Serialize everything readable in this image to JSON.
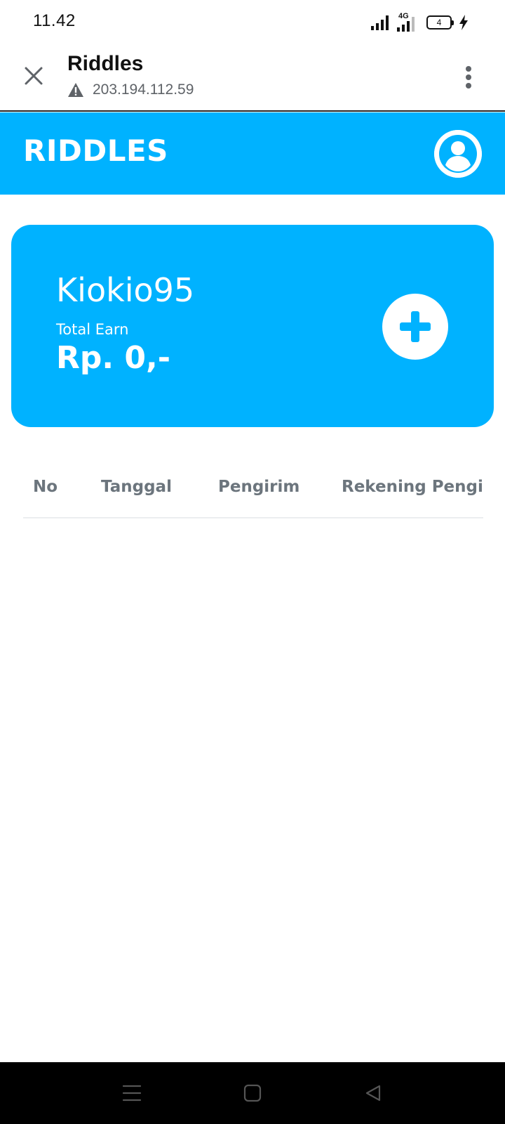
{
  "status_bar": {
    "time": "11.42",
    "network_label": "4G",
    "battery_level": "4",
    "icons": [
      "signal-icon",
      "4g-signal-icon",
      "battery-icon",
      "charging-icon"
    ]
  },
  "browser": {
    "title": "Riddles",
    "url": "203.194.112.59",
    "icons": [
      "close-icon",
      "warning-icon",
      "more-vert-icon"
    ]
  },
  "header": {
    "title": "RIDDLES",
    "icon": "account-circle-icon"
  },
  "card": {
    "username": "Kiokio95",
    "earn_label": "Total Earn",
    "earn_value": "Rp. 0,-",
    "icon": "plus-icon"
  },
  "table": {
    "columns": [
      "No",
      "Tanggal",
      "Pengirim",
      "Rekening Pengirim"
    ],
    "rows": []
  },
  "navbar": {
    "icons": [
      "menu-icon",
      "home-square-icon",
      "back-triangle-icon"
    ]
  },
  "colors": {
    "accent": "#00b2ff",
    "table_header_text": "#6c757d",
    "url_text": "#5f6368"
  }
}
